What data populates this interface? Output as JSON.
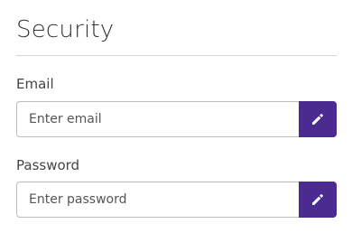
{
  "section": {
    "title": "Security"
  },
  "fields": [
    {
      "label": "Email",
      "value": "",
      "placeholder": "Enter email",
      "button_icon": "pencil-icon"
    },
    {
      "label": "Password",
      "value": "",
      "placeholder": "Enter password",
      "button_icon": "pencil-icon"
    }
  ],
  "colors": {
    "accent": "#4b2a91",
    "border": "#bdbdbd",
    "divider": "#d6d6d6",
    "text": "#333333"
  }
}
